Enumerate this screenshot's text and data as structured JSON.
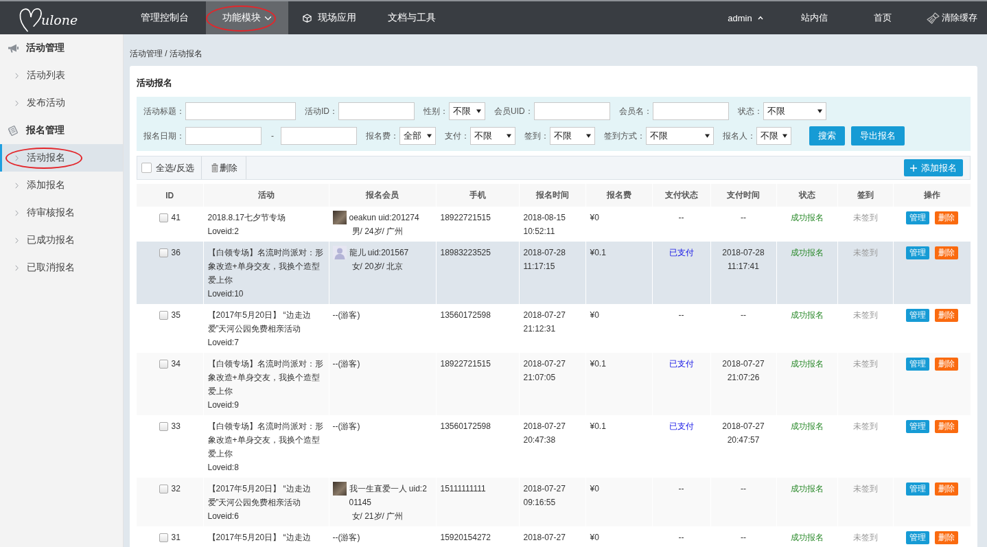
{
  "top_nav": {
    "logo": "ulone",
    "items": [
      {
        "label": "管理控制台",
        "kind": "plain",
        "selected": false,
        "annotated": false
      },
      {
        "label": "功能模块",
        "kind": "dropdown",
        "selected": true,
        "annotated": true
      },
      {
        "label": "现场应用",
        "kind": "apps",
        "selected": false,
        "annotated": false
      },
      {
        "label": "文档与工具",
        "kind": "plain",
        "selected": false,
        "annotated": false
      }
    ],
    "right_items": [
      {
        "label": "admin",
        "kind": "account"
      },
      {
        "label": "站内信",
        "kind": "plain"
      },
      {
        "label": "首页",
        "kind": "plain"
      },
      {
        "label": "清除缓存",
        "kind": "cache"
      }
    ]
  },
  "sidebar": {
    "groups": [
      {
        "label": "活动管理",
        "kind": "megaphone",
        "items": [
          {
            "label": "活动列表",
            "selected": false,
            "annotated": false
          },
          {
            "label": "发布活动",
            "selected": false,
            "annotated": false
          }
        ]
      },
      {
        "label": "报名管理",
        "kind": "notebook",
        "items": [
          {
            "label": "活动报名",
            "selected": true,
            "annotated": true
          },
          {
            "label": "添加报名",
            "selected": false,
            "annotated": false
          },
          {
            "label": "待审核报名",
            "selected": false,
            "annotated": false
          },
          {
            "label": "已成功报名",
            "selected": false,
            "annotated": false
          },
          {
            "label": "已取消报名",
            "selected": false,
            "annotated": false
          }
        ]
      }
    ]
  },
  "breadcrumb": "活动管理 / 活动报名",
  "panel": {
    "title": "活动报名",
    "filters": [
      [
        {
          "kind": "input",
          "label": "活动标题："
        },
        {
          "kind": "input",
          "label": "活动ID："
        },
        {
          "kind": "select",
          "label": "性别：",
          "value": "不限"
        },
        {
          "kind": "input",
          "label": "会员UID："
        },
        {
          "kind": "input",
          "label": "会员名："
        },
        {
          "kind": "select",
          "label": "状态：",
          "value": "不限"
        }
      ],
      [
        {
          "kind": "range",
          "label": "报名日期：",
          "separator": "-"
        },
        {
          "kind": "select",
          "label": "报名费：",
          "value": "全部"
        },
        {
          "kind": "select",
          "label": "支付：",
          "value": "不限"
        },
        {
          "kind": "select",
          "label": "签到：",
          "value": "不限"
        },
        {
          "kind": "select",
          "label": "签到方式：",
          "value": "不限"
        },
        {
          "kind": "select",
          "label": "报名人：",
          "value": "不限"
        },
        {
          "kind": "search",
          "label": "搜索"
        },
        {
          "kind": "export",
          "label": "导出报名"
        }
      ]
    ],
    "toolbar": {
      "select_all": {
        "label": "全选/反选",
        "checked": false
      },
      "delete": "删除",
      "add": "添加报名"
    },
    "table": {
      "columns": [
        "ID",
        "活动",
        "报名会员",
        "手机",
        "报名时间",
        "报名费",
        "支付状态",
        "支付时间",
        "状态",
        "签到",
        "操作"
      ],
      "rows": [
        {
          "id": "41",
          "checked": false,
          "hovered": false,
          "title": "2018.8.17七夕节专场",
          "loveid": "Loveid:2",
          "member": {
            "kind": "user",
            "avatar": {
              "kind": "photo"
            },
            "name": "oeakun uid:201274",
            "info": "男/ 24岁/ 广州"
          },
          "phone": "18922721515",
          "signup_time": "2018-08-15 10:52:11",
          "fee": "¥0",
          "pay_status": "--",
          "paid": false,
          "pay_time": "--",
          "status": "成功报名",
          "checkin": "未签到",
          "actions": [
            {
              "kind": "manage",
              "label": "管理"
            },
            {
              "kind": "delete",
              "label": "删除"
            }
          ]
        },
        {
          "id": "36",
          "checked": false,
          "hovered": true,
          "title": "【白领专场】名流时尚派对：形象改造+单身交友，我换个造型爱上你",
          "loveid": "Loveid:10",
          "member": {
            "kind": "user",
            "avatar": {
              "kind": "default"
            },
            "name": "龍儿 uid:201567",
            "info": "女/ 20岁/ 北京"
          },
          "phone": "18983223525",
          "signup_time": "2018-07-28 11:17:15",
          "fee": "¥0.1",
          "pay_status": "已支付",
          "paid": true,
          "pay_time": "2018-07-28 11:17:41",
          "status": "成功报名",
          "checkin": "未签到",
          "actions": [
            {
              "kind": "manage",
              "label": "管理"
            },
            {
              "kind": "delete",
              "label": "删除"
            }
          ]
        },
        {
          "id": "35",
          "checked": false,
          "hovered": false,
          "title": "【2017年5月20日】 “边走边爱”天河公园免费相亲活动",
          "loveid": "Loveid:7",
          "member": {
            "kind": "guest",
            "name": "--(游客)"
          },
          "phone": "13560172598",
          "signup_time": "2018-07-27 21:12:31",
          "fee": "¥0",
          "pay_status": "--",
          "paid": false,
          "pay_time": "--",
          "status": "成功报名",
          "checkin": "未签到",
          "actions": [
            {
              "kind": "manage",
              "label": "管理"
            },
            {
              "kind": "delete",
              "label": "删除"
            }
          ]
        },
        {
          "id": "34",
          "checked": false,
          "hovered": false,
          "title": "【白领专场】名流时尚派对：形象改造+单身交友，我换个造型爱上你",
          "loveid": "Loveid:9",
          "member": {
            "kind": "guest",
            "name": "--(游客)"
          },
          "phone": "18922721515",
          "signup_time": "2018-07-27 21:07:05",
          "fee": "¥0.1",
          "pay_status": "已支付",
          "paid": true,
          "pay_time": "2018-07-27 21:07:26",
          "status": "成功报名",
          "checkin": "未签到",
          "actions": [
            {
              "kind": "manage",
              "label": "管理"
            },
            {
              "kind": "delete",
              "label": "删除"
            }
          ]
        },
        {
          "id": "33",
          "checked": false,
          "hovered": false,
          "title": "【白领专场】名流时尚派对：形象改造+单身交友，我换个造型爱上你",
          "loveid": "Loveid:8",
          "member": {
            "kind": "guest",
            "name": "--(游客)"
          },
          "phone": "13560172598",
          "signup_time": "2018-07-27 20:47:38",
          "fee": "¥0.1",
          "pay_status": "已支付",
          "paid": true,
          "pay_time": "2018-07-27 20:47:57",
          "status": "成功报名",
          "checkin": "未签到",
          "actions": [
            {
              "kind": "manage",
              "label": "管理"
            },
            {
              "kind": "delete",
              "label": "删除"
            }
          ]
        },
        {
          "id": "32",
          "checked": false,
          "hovered": false,
          "title": "【2017年5月20日】 “边走边爱”天河公园免费相亲活动",
          "loveid": "Loveid:6",
          "member": {
            "kind": "user",
            "avatar": {
              "kind": "photo"
            },
            "name": "我一生直爱一人 uid:201145",
            "info": "女/ 21岁/ 广州"
          },
          "phone": "15111111111",
          "signup_time": "2018-07-27 09:16:55",
          "fee": "¥0",
          "pay_status": "--",
          "paid": false,
          "pay_time": "--",
          "status": "成功报名",
          "checkin": "未签到",
          "actions": [
            {
              "kind": "manage",
              "label": "管理"
            },
            {
              "kind": "delete",
              "label": "删除"
            }
          ]
        },
        {
          "id": "31",
          "checked": false,
          "hovered": false,
          "title": "【2017年5月20日】 “边走边",
          "member": {
            "kind": "guest",
            "name": "--(游客)"
          },
          "phone": "15920154272",
          "signup_time": "2018-07-27",
          "fee": "¥0",
          "pay_status": "--",
          "paid": false,
          "pay_time": "--",
          "status": "成功报名",
          "checkin": "未签到",
          "actions": [
            {
              "kind": "manage",
              "label": "管理"
            },
            {
              "kind": "delete",
              "label": "删除"
            }
          ]
        }
      ]
    }
  }
}
